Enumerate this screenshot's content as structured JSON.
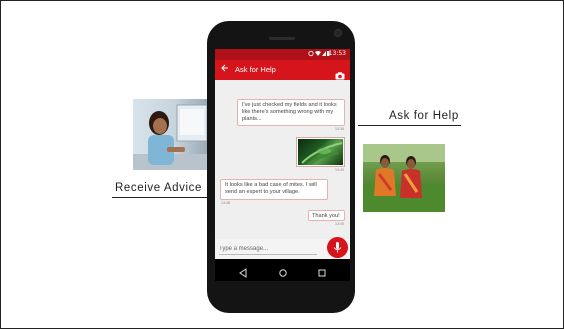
{
  "left_caption": "Receive Advice",
  "right_caption": "Ask for Help",
  "phone": {
    "status": {
      "time": "13:53",
      "icons": "wifi-icon signal-icon battery-icon"
    },
    "app_bar": {
      "title": "Ask for Help",
      "back_icon": "arrow-back-icon",
      "action_icon": "camera-icon"
    },
    "messages": [
      {
        "side": "right",
        "text": "I've just checked my fields and it looks like there's something wrong with my plants...",
        "time": "13:36"
      },
      {
        "side": "right",
        "type": "image",
        "time": "13:40"
      },
      {
        "side": "left",
        "text": "It looks like a bad case of mites. I will send an expert to your village.",
        "time": "13:48"
      },
      {
        "side": "right",
        "text": "Thank you!",
        "time": "13:49"
      }
    ],
    "composer": {
      "placeholder": "Type a message...",
      "mic_icon": "microphone-icon"
    },
    "nav": [
      "back-triangle-icon",
      "home-circle-icon",
      "recents-square-icon"
    ]
  },
  "colors": {
    "brand_red": "#d6141b",
    "status_red": "#b01017"
  }
}
